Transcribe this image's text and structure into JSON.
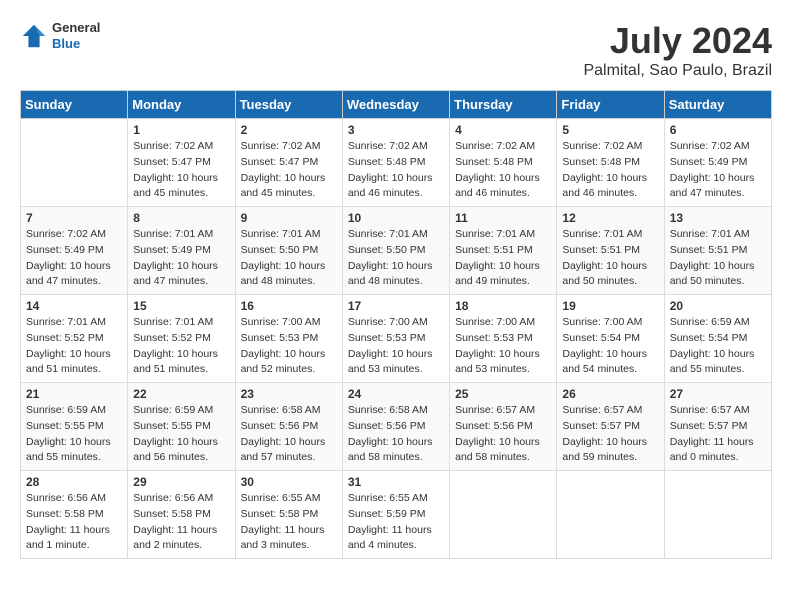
{
  "logo": {
    "general": "General",
    "blue": "Blue"
  },
  "title": "July 2024",
  "location": "Palmital, Sao Paulo, Brazil",
  "days_of_week": [
    "Sunday",
    "Monday",
    "Tuesday",
    "Wednesday",
    "Thursday",
    "Friday",
    "Saturday"
  ],
  "weeks": [
    [
      {
        "day": "",
        "info": ""
      },
      {
        "day": "1",
        "info": "Sunrise: 7:02 AM\nSunset: 5:47 PM\nDaylight: 10 hours\nand 45 minutes."
      },
      {
        "day": "2",
        "info": "Sunrise: 7:02 AM\nSunset: 5:47 PM\nDaylight: 10 hours\nand 45 minutes."
      },
      {
        "day": "3",
        "info": "Sunrise: 7:02 AM\nSunset: 5:48 PM\nDaylight: 10 hours\nand 46 minutes."
      },
      {
        "day": "4",
        "info": "Sunrise: 7:02 AM\nSunset: 5:48 PM\nDaylight: 10 hours\nand 46 minutes."
      },
      {
        "day": "5",
        "info": "Sunrise: 7:02 AM\nSunset: 5:48 PM\nDaylight: 10 hours\nand 46 minutes."
      },
      {
        "day": "6",
        "info": "Sunrise: 7:02 AM\nSunset: 5:49 PM\nDaylight: 10 hours\nand 47 minutes."
      }
    ],
    [
      {
        "day": "7",
        "info": "Sunrise: 7:02 AM\nSunset: 5:49 PM\nDaylight: 10 hours\nand 47 minutes."
      },
      {
        "day": "8",
        "info": "Sunrise: 7:01 AM\nSunset: 5:49 PM\nDaylight: 10 hours\nand 47 minutes."
      },
      {
        "day": "9",
        "info": "Sunrise: 7:01 AM\nSunset: 5:50 PM\nDaylight: 10 hours\nand 48 minutes."
      },
      {
        "day": "10",
        "info": "Sunrise: 7:01 AM\nSunset: 5:50 PM\nDaylight: 10 hours\nand 48 minutes."
      },
      {
        "day": "11",
        "info": "Sunrise: 7:01 AM\nSunset: 5:51 PM\nDaylight: 10 hours\nand 49 minutes."
      },
      {
        "day": "12",
        "info": "Sunrise: 7:01 AM\nSunset: 5:51 PM\nDaylight: 10 hours\nand 50 minutes."
      },
      {
        "day": "13",
        "info": "Sunrise: 7:01 AM\nSunset: 5:51 PM\nDaylight: 10 hours\nand 50 minutes."
      }
    ],
    [
      {
        "day": "14",
        "info": "Sunrise: 7:01 AM\nSunset: 5:52 PM\nDaylight: 10 hours\nand 51 minutes."
      },
      {
        "day": "15",
        "info": "Sunrise: 7:01 AM\nSunset: 5:52 PM\nDaylight: 10 hours\nand 51 minutes."
      },
      {
        "day": "16",
        "info": "Sunrise: 7:00 AM\nSunset: 5:53 PM\nDaylight: 10 hours\nand 52 minutes."
      },
      {
        "day": "17",
        "info": "Sunrise: 7:00 AM\nSunset: 5:53 PM\nDaylight: 10 hours\nand 53 minutes."
      },
      {
        "day": "18",
        "info": "Sunrise: 7:00 AM\nSunset: 5:53 PM\nDaylight: 10 hours\nand 53 minutes."
      },
      {
        "day": "19",
        "info": "Sunrise: 7:00 AM\nSunset: 5:54 PM\nDaylight: 10 hours\nand 54 minutes."
      },
      {
        "day": "20",
        "info": "Sunrise: 6:59 AM\nSunset: 5:54 PM\nDaylight: 10 hours\nand 55 minutes."
      }
    ],
    [
      {
        "day": "21",
        "info": "Sunrise: 6:59 AM\nSunset: 5:55 PM\nDaylight: 10 hours\nand 55 minutes."
      },
      {
        "day": "22",
        "info": "Sunrise: 6:59 AM\nSunset: 5:55 PM\nDaylight: 10 hours\nand 56 minutes."
      },
      {
        "day": "23",
        "info": "Sunrise: 6:58 AM\nSunset: 5:56 PM\nDaylight: 10 hours\nand 57 minutes."
      },
      {
        "day": "24",
        "info": "Sunrise: 6:58 AM\nSunset: 5:56 PM\nDaylight: 10 hours\nand 58 minutes."
      },
      {
        "day": "25",
        "info": "Sunrise: 6:57 AM\nSunset: 5:56 PM\nDaylight: 10 hours\nand 58 minutes."
      },
      {
        "day": "26",
        "info": "Sunrise: 6:57 AM\nSunset: 5:57 PM\nDaylight: 10 hours\nand 59 minutes."
      },
      {
        "day": "27",
        "info": "Sunrise: 6:57 AM\nSunset: 5:57 PM\nDaylight: 11 hours\nand 0 minutes."
      }
    ],
    [
      {
        "day": "28",
        "info": "Sunrise: 6:56 AM\nSunset: 5:58 PM\nDaylight: 11 hours\nand 1 minute."
      },
      {
        "day": "29",
        "info": "Sunrise: 6:56 AM\nSunset: 5:58 PM\nDaylight: 11 hours\nand 2 minutes."
      },
      {
        "day": "30",
        "info": "Sunrise: 6:55 AM\nSunset: 5:58 PM\nDaylight: 11 hours\nand 3 minutes."
      },
      {
        "day": "31",
        "info": "Sunrise: 6:55 AM\nSunset: 5:59 PM\nDaylight: 11 hours\nand 4 minutes."
      },
      {
        "day": "",
        "info": ""
      },
      {
        "day": "",
        "info": ""
      },
      {
        "day": "",
        "info": ""
      }
    ]
  ]
}
